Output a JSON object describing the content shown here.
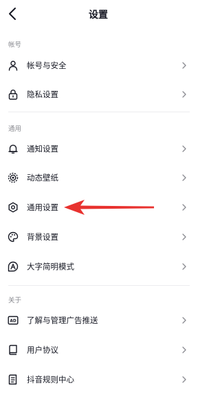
{
  "header": {
    "title": "设置"
  },
  "sections": {
    "account": {
      "label": "帐号",
      "items": [
        {
          "label": "帐号与安全",
          "icon": "user-icon"
        },
        {
          "label": "隐私设置",
          "icon": "lock-icon"
        }
      ]
    },
    "general": {
      "label": "通用",
      "items": [
        {
          "label": "通知设置",
          "icon": "bell-icon"
        },
        {
          "label": "动态壁纸",
          "icon": "live-wallpaper-icon"
        },
        {
          "label": "通用设置",
          "icon": "gear-icon"
        },
        {
          "label": "背景设置",
          "icon": "palette-icon"
        },
        {
          "label": "大字简明模式",
          "icon": "large-text-icon"
        }
      ]
    },
    "about": {
      "label": "关于",
      "items": [
        {
          "label": "了解与管理广告推送",
          "icon": "ad-icon"
        },
        {
          "label": "用户协议",
          "icon": "book-icon"
        },
        {
          "label": "抖音规则中心",
          "icon": "rules-icon"
        }
      ]
    }
  },
  "annotation": {
    "arrow_color": "#e8322f",
    "points_to": "通用设置"
  },
  "colors": {
    "text": "#161823",
    "section_label": "#8a8b91",
    "divider": "#ececef",
    "chevron": "#8a8b91"
  }
}
